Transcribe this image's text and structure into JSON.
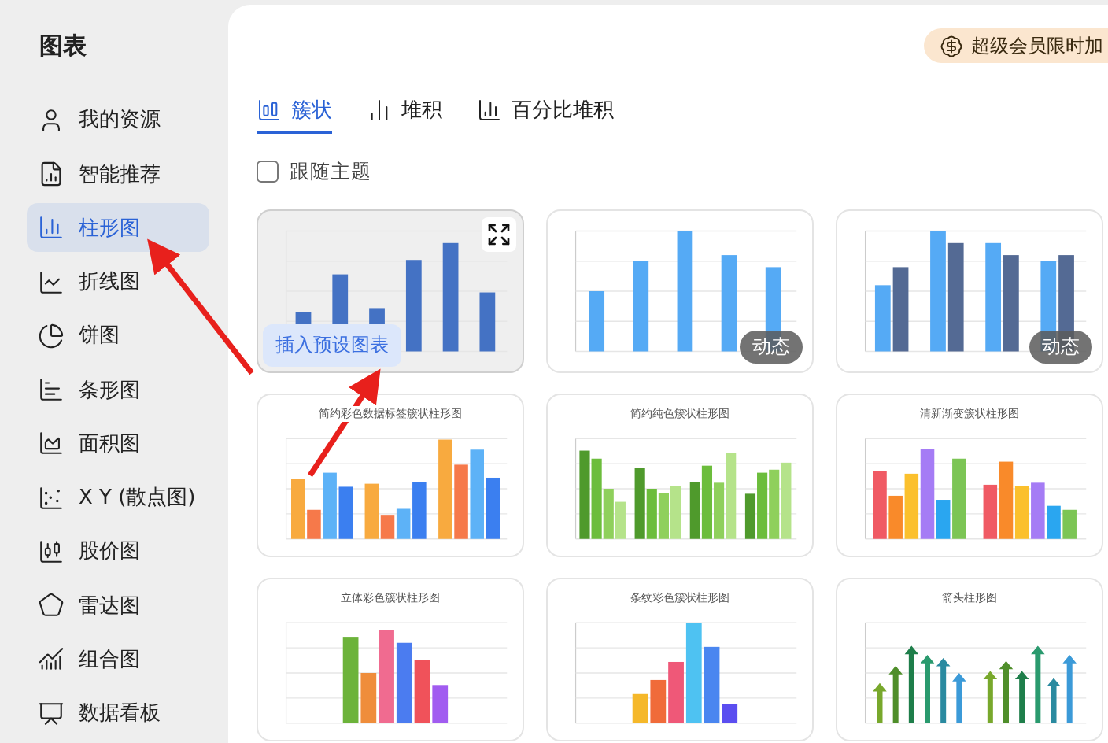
{
  "sidebar": {
    "title": "图表",
    "items": [
      {
        "label": "我的资源",
        "selected": false
      },
      {
        "label": "智能推荐",
        "selected": false
      },
      {
        "label": "柱形图",
        "selected": true
      },
      {
        "label": "折线图",
        "selected": false
      },
      {
        "label": "饼图",
        "selected": false
      },
      {
        "label": "条形图",
        "selected": false
      },
      {
        "label": "面积图",
        "selected": false
      },
      {
        "label": "X Y (散点图)",
        "selected": false
      },
      {
        "label": "股价图",
        "selected": false
      },
      {
        "label": "雷达图",
        "selected": false
      },
      {
        "label": "组合图",
        "selected": false
      },
      {
        "label": "数据看板",
        "selected": false
      }
    ]
  },
  "promo": {
    "label": "超级会员限时加"
  },
  "tabs": [
    {
      "label": "簇状",
      "selected": true
    },
    {
      "label": "堆积",
      "selected": false
    },
    {
      "label": "百分比堆积",
      "selected": false
    }
  ],
  "follow_theme": {
    "label": "跟随主题",
    "checked": false
  },
  "cards": [
    {
      "hovered": true,
      "action": "插入预设图表"
    },
    {
      "hovered": false,
      "badge": "动态"
    },
    {
      "hovered": false,
      "badge": "动态"
    },
    {
      "hovered": false,
      "title": "简约彩色数据标签簇状柱形图"
    },
    {
      "hovered": false,
      "title": "简约纯色簇状柱形图"
    },
    {
      "hovered": false,
      "title": "清新渐变簇状柱形图"
    },
    {
      "hovered": false,
      "title": "立体彩色簇状柱形图"
    },
    {
      "hovered": false,
      "title": "条纹彩色簇状柱形图"
    },
    {
      "hovered": false,
      "title": "箭头柱形图"
    }
  ]
}
